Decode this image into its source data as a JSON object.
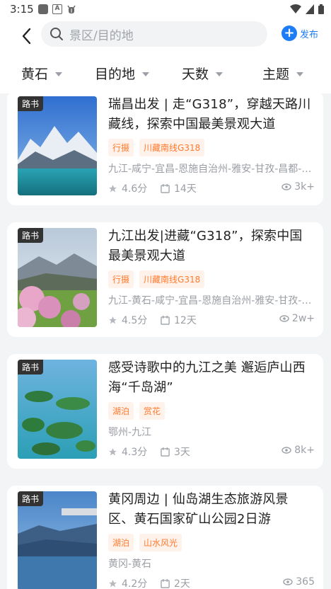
{
  "status_bar": {
    "time": "3:15",
    "a_icon_letter": "A"
  },
  "header": {
    "search_placeholder": "景区/目的地",
    "publish_label": "发布"
  },
  "filters": [
    {
      "label": "黄石"
    },
    {
      "label": "目的地"
    },
    {
      "label": "天数"
    },
    {
      "label": "主题"
    }
  ],
  "cards": [
    {
      "badge": "路书",
      "title": "瑞昌出发 | 走“G318”，穿越天路川藏线，探索中国最美景观大道",
      "tags": [
        "行摄",
        "川藏南线G318"
      ],
      "route": "九江-咸宁-宜昌-恩施自治州-雅安-甘孜-昌都-林芝-拉萨",
      "rating": "4.6分",
      "days": "14天",
      "views": "3k+"
    },
    {
      "badge": "路书",
      "title": "九江出发|进藏“G318”，探索中国最美景观大道",
      "tags": [
        "行摄",
        "川藏南线G318"
      ],
      "route": "九江-黄石-咸宁-宜昌-恩施自治州-雅安-甘孜-昌都-林芝-拉萨",
      "rating": "4.5分",
      "days": "12天",
      "views": "2w+"
    },
    {
      "badge": "路书",
      "title": "感受诗歌中的九江之美 邂逅庐山西海“千岛湖”",
      "tags": [
        "湖泊",
        "赏花"
      ],
      "route": "鄂州-九江",
      "rating": "4.3分",
      "days": "3天",
      "views": "8k+"
    },
    {
      "badge": "路书",
      "title": "黄冈周边 | 仙岛湖生态旅游风景区、黄石国家矿山公园2日游",
      "tags": [
        "湖泊",
        "山水风光"
      ],
      "route": "黄冈-黄石",
      "rating": "4.2分",
      "days": "2天",
      "views": "365"
    }
  ],
  "colors": {
    "accent": "#1e7cf5",
    "tag_text": "#ff7a2e",
    "tag_bg": "#fff2ea"
  }
}
